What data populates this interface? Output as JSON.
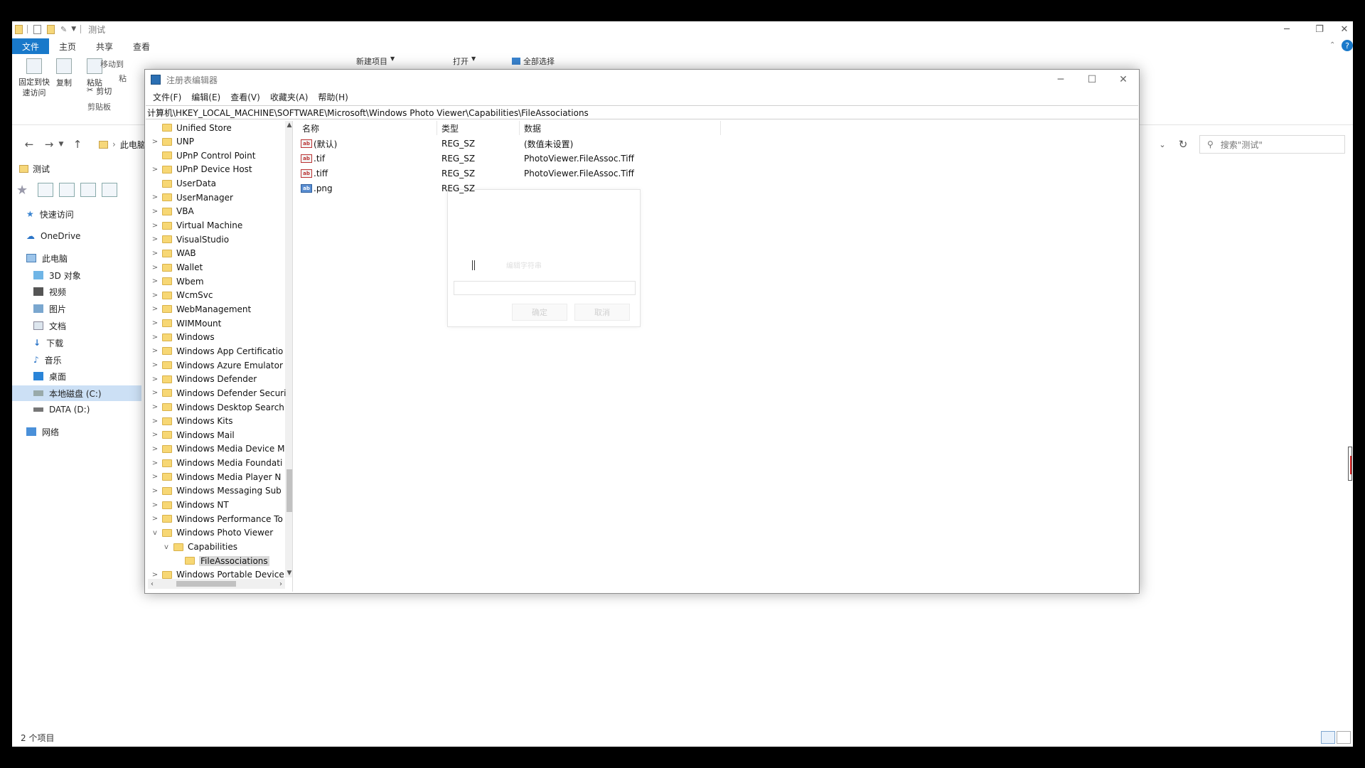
{
  "explorer": {
    "title": "测试",
    "ribbon_tabs": [
      "文件",
      "主页",
      "共享",
      "查看"
    ],
    "ribbon_buttons": {
      "pin": "固定到快速访问",
      "copy": "复制",
      "paste": "粘贴",
      "cut": "剪切",
      "group_clipboard": "剪贴板",
      "new_item": "新建项目",
      "open": "打开",
      "select_all": "全部选择",
      "move_to": "移动到",
      "paste_short": "粘"
    },
    "address": {
      "computer": "此电脑"
    },
    "search_placeholder": "搜索\"测试\"",
    "folder_tab": "测试",
    "nav": {
      "quick_access": "快速访问",
      "onedrive": "OneDrive",
      "this_pc": "此电脑",
      "objects_3d": "3D 对象",
      "videos": "视频",
      "pictures": "图片",
      "documents": "文档",
      "downloads": "下载",
      "music": "音乐",
      "desktop": "桌面",
      "local_disk": "本地磁盘 (C:)",
      "data_disk": "DATA (D:)",
      "network": "网络"
    },
    "status": "2 个项目"
  },
  "regedit": {
    "title": "注册表编辑器",
    "menu": [
      "文件(F)",
      "编辑(E)",
      "查看(V)",
      "收藏夹(A)",
      "帮助(H)"
    ],
    "address": "计算机\\HKEY_LOCAL_MACHINE\\SOFTWARE\\Microsoft\\Windows Photo Viewer\\Capabilities\\FileAssociations",
    "tree": [
      {
        "label": "Unified Store",
        "expander": "",
        "indent": 0,
        "selected": false
      },
      {
        "label": "UNP",
        "expander": ">",
        "indent": 0,
        "selected": false
      },
      {
        "label": "UPnP Control Point",
        "expander": "",
        "indent": 0,
        "selected": false
      },
      {
        "label": "UPnP Device Host",
        "expander": ">",
        "indent": 0,
        "selected": false
      },
      {
        "label": "UserData",
        "expander": "",
        "indent": 0,
        "selected": false
      },
      {
        "label": "UserManager",
        "expander": ">",
        "indent": 0,
        "selected": false
      },
      {
        "label": "VBA",
        "expander": ">",
        "indent": 0,
        "selected": false
      },
      {
        "label": "Virtual Machine",
        "expander": ">",
        "indent": 0,
        "selected": false
      },
      {
        "label": "VisualStudio",
        "expander": ">",
        "indent": 0,
        "selected": false
      },
      {
        "label": "WAB",
        "expander": ">",
        "indent": 0,
        "selected": false
      },
      {
        "label": "Wallet",
        "expander": ">",
        "indent": 0,
        "selected": false
      },
      {
        "label": "Wbem",
        "expander": ">",
        "indent": 0,
        "selected": false
      },
      {
        "label": "WcmSvc",
        "expander": ">",
        "indent": 0,
        "selected": false
      },
      {
        "label": "WebManagement",
        "expander": ">",
        "indent": 0,
        "selected": false
      },
      {
        "label": "WIMMount",
        "expander": ">",
        "indent": 0,
        "selected": false
      },
      {
        "label": "Windows",
        "expander": ">",
        "indent": 0,
        "selected": false
      },
      {
        "label": "Windows App Certificatio",
        "expander": ">",
        "indent": 0,
        "selected": false
      },
      {
        "label": "Windows Azure Emulator",
        "expander": ">",
        "indent": 0,
        "selected": false
      },
      {
        "label": "Windows Defender",
        "expander": ">",
        "indent": 0,
        "selected": false
      },
      {
        "label": "Windows Defender Securi",
        "expander": ">",
        "indent": 0,
        "selected": false
      },
      {
        "label": "Windows Desktop Search",
        "expander": ">",
        "indent": 0,
        "selected": false
      },
      {
        "label": "Windows Kits",
        "expander": ">",
        "indent": 0,
        "selected": false
      },
      {
        "label": "Windows Mail",
        "expander": ">",
        "indent": 0,
        "selected": false
      },
      {
        "label": "Windows Media Device M",
        "expander": ">",
        "indent": 0,
        "selected": false
      },
      {
        "label": "Windows Media Foundati",
        "expander": ">",
        "indent": 0,
        "selected": false
      },
      {
        "label": "Windows Media Player N",
        "expander": ">",
        "indent": 0,
        "selected": false
      },
      {
        "label": "Windows Messaging Sub",
        "expander": ">",
        "indent": 0,
        "selected": false
      },
      {
        "label": "Windows NT",
        "expander": ">",
        "indent": 0,
        "selected": false
      },
      {
        "label": "Windows Performance To",
        "expander": ">",
        "indent": 0,
        "selected": false
      },
      {
        "label": "Windows Photo Viewer",
        "expander": "v",
        "indent": 0,
        "selected": false
      },
      {
        "label": "Capabilities",
        "expander": "v",
        "indent": 1,
        "selected": false
      },
      {
        "label": "FileAssociations",
        "expander": "",
        "indent": 2,
        "selected": true
      },
      {
        "label": "Windows Portable Device",
        "expander": ">",
        "indent": 0,
        "selected": false
      }
    ],
    "columns": [
      "名称",
      "类型",
      "数据"
    ],
    "values": [
      {
        "name": "(默认)",
        "type": "REG_SZ",
        "data": "(数值未设置)",
        "selected": false
      },
      {
        "name": ".tif",
        "type": "REG_SZ",
        "data": "PhotoViewer.FileAssoc.Tiff",
        "selected": false
      },
      {
        "name": ".tiff",
        "type": "REG_SZ",
        "data": "PhotoViewer.FileAssoc.Tiff",
        "selected": false
      },
      {
        "name": ".png",
        "type": "REG_SZ",
        "data": "",
        "selected": true
      }
    ],
    "ghost_dialog": {
      "title": "编辑字符串",
      "ok": "确定",
      "cancel": "取消"
    }
  }
}
